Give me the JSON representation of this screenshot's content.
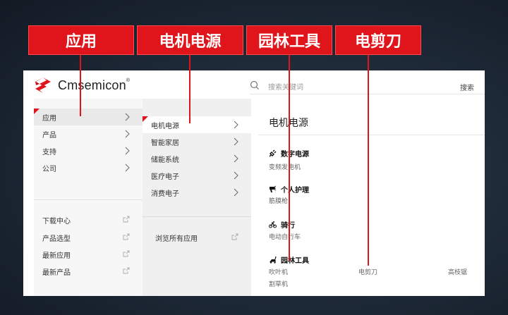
{
  "tags": [
    "应用",
    "电机电源",
    "园林工具",
    "电剪刀"
  ],
  "brand": {
    "name": "Cmsemicon",
    "mark": "®"
  },
  "search": {
    "placeholder": "搜索关键词",
    "button": "搜索"
  },
  "menu1": {
    "items": [
      "应用",
      "产品",
      "支持",
      "公司"
    ],
    "links": [
      "下载中心",
      "产品选型",
      "最新应用",
      "最新产品"
    ]
  },
  "menu2": {
    "items": [
      "电机电源",
      "智能家居",
      "储能系统",
      "医疗电子",
      "消费电子"
    ],
    "browse_all": "浏览所有应用"
  },
  "detail": {
    "title": "电机电源",
    "categories": [
      {
        "name": "数字电源",
        "icon": "plug-icon",
        "subs": [
          "变频发电机"
        ]
      },
      {
        "name": "个人护理",
        "icon": "hairdryer-icon",
        "subs": [
          "筋膜枪"
        ]
      },
      {
        "name": "骑行",
        "icon": "bicycle-icon",
        "subs": [
          "电动自行车"
        ]
      },
      {
        "name": "园林工具",
        "icon": "mower-icon",
        "subs": [
          "吹叶机",
          "电剪刀",
          "高枝锯",
          "割草机"
        ]
      }
    ]
  },
  "colors": {
    "accent": "#e0151b",
    "background": "#1d2836"
  }
}
